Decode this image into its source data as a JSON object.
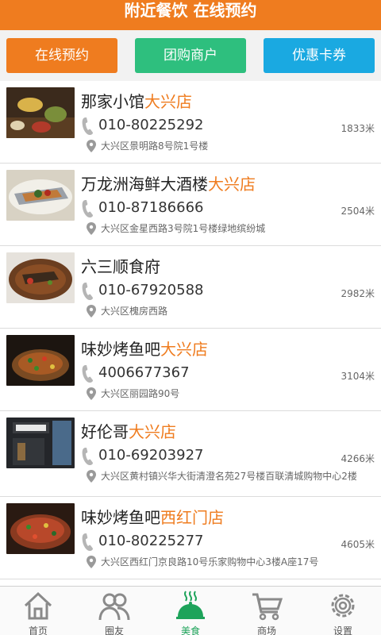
{
  "header": {
    "title": "附近餐饮 在线预约"
  },
  "tabs": [
    {
      "label": "在线预约",
      "color": "#ef7c1f"
    },
    {
      "label": "团购商户",
      "color": "#2ebf7e"
    },
    {
      "label": "优惠卡券",
      "color": "#1aa9e1"
    }
  ],
  "restaurants": [
    {
      "name": "那家小馆",
      "branch": "大兴店",
      "phone": "010-80225292",
      "distance": "1833米",
      "address": "大兴区景明路8号院1号楼"
    },
    {
      "name": "万龙洲海鲜大酒楼",
      "branch": "大兴店",
      "phone": "010-87186666",
      "distance": "2504米",
      "address": "大兴区金星西路3号院1号楼绿地缤纷城"
    },
    {
      "name": "六三顺食府",
      "branch": "",
      "phone": "010-67920588",
      "distance": "2982米",
      "address": "大兴区槐房西路"
    },
    {
      "name": "味妙烤鱼吧",
      "branch": "大兴店",
      "phone": "4006677367",
      "distance": "3104米",
      "address": "大兴区丽园路90号"
    },
    {
      "name": "好伦哥",
      "branch": "大兴店",
      "phone": "010-69203927",
      "distance": "4266米",
      "address": "大兴区黄村镇兴华大街清澄名苑27号楼百联清城购物中心2楼"
    },
    {
      "name": "味妙烤鱼吧",
      "branch": "西红门店",
      "phone": "010-80225277",
      "distance": "4605米",
      "address": "大兴区西红门京良路10号乐家购物中心3楼A座17号"
    }
  ],
  "bottom_nav": [
    {
      "label": "首页",
      "icon": "home-icon"
    },
    {
      "label": "圈友",
      "icon": "friends-icon"
    },
    {
      "label": "美食",
      "icon": "food-cloche-icon",
      "active": true
    },
    {
      "label": "商场",
      "icon": "shopping-cart-icon"
    },
    {
      "label": "设置",
      "icon": "gear-icon"
    }
  ],
  "colors": {
    "accent": "#ef7c1f",
    "active_nav": "#1da35a"
  }
}
